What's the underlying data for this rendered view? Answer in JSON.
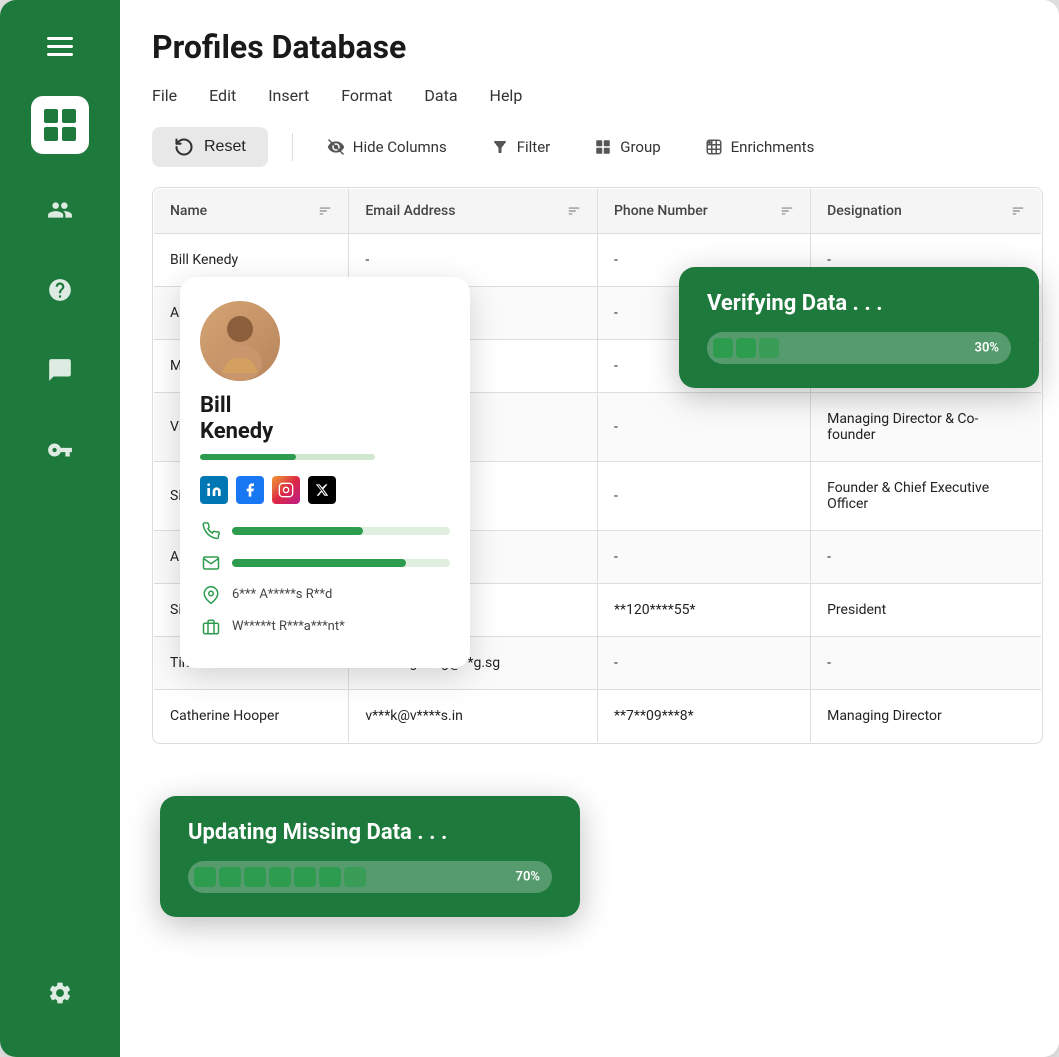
{
  "app": {
    "title": "Profiles Database"
  },
  "menu": {
    "items": [
      {
        "label": "File"
      },
      {
        "label": "Edit"
      },
      {
        "label": "Insert"
      },
      {
        "label": "Format"
      },
      {
        "label": "Data"
      },
      {
        "label": "Help"
      }
    ]
  },
  "toolbar": {
    "reset_label": "Reset",
    "hide_columns_label": "Hide Columns",
    "filter_label": "Filter",
    "group_label": "Group",
    "enrichments_label": "Enrichments"
  },
  "table": {
    "columns": [
      {
        "label": "Name"
      },
      {
        "label": "Email Address"
      },
      {
        "label": "Phone Number"
      },
      {
        "label": "Designation"
      }
    ],
    "rows": [
      {
        "name": "Bill Kenedy",
        "email": "-",
        "phone": "-",
        "designation": "-"
      },
      {
        "name": "A...",
        "email": "-",
        "phone": "-",
        "designation": "-"
      },
      {
        "name": "M...",
        "email": "-",
        "phone": "-",
        "designation": "-"
      },
      {
        "name": "Vi...",
        "email": "-",
        "phone": "-",
        "designation": "Managing Director & Co-founder"
      },
      {
        "name": "Si...",
        "email": "-",
        "phone": "-",
        "designation": "Founder & Chief Executive Officer"
      },
      {
        "name": "Al...",
        "email": "-",
        "phone": "-",
        "designation": "-"
      },
      {
        "name": "Simon Samuels",
        "email": "-",
        "phone": "**120****55*",
        "designation": "President"
      },
      {
        "name": "Timothee Ross",
        "email": "t****i**g.b**g@**g.sg",
        "phone": "-",
        "designation": "-"
      },
      {
        "name": "Catherine Hooper",
        "email": "v***k@v****s.in",
        "phone": "**7**09***8*",
        "designation": "Managing Director"
      }
    ]
  },
  "profile_card": {
    "name": "Bill\nKenedy",
    "phone_masked": true,
    "email_masked": true,
    "address": "6*** A*****s R**d",
    "company": "W*****t R***a***nt*",
    "socials": [
      "LinkedIn",
      "Facebook",
      "Instagram",
      "X"
    ]
  },
  "verifying_popup": {
    "title": "Verifying Data . . .",
    "progress_percent": "30%",
    "progress_value": 30
  },
  "updating_popup": {
    "title": "Updating Missing Data . . .",
    "progress_percent": "70%",
    "progress_value": 70
  },
  "sidebar": {
    "nav_items": [
      {
        "icon": "people-icon",
        "label": "People"
      },
      {
        "icon": "help-icon",
        "label": "Help"
      },
      {
        "icon": "chat-icon",
        "label": "Chat"
      },
      {
        "icon": "key-icon",
        "label": "Key"
      }
    ],
    "bottom_items": [
      {
        "icon": "settings-icon",
        "label": "Settings"
      }
    ]
  }
}
